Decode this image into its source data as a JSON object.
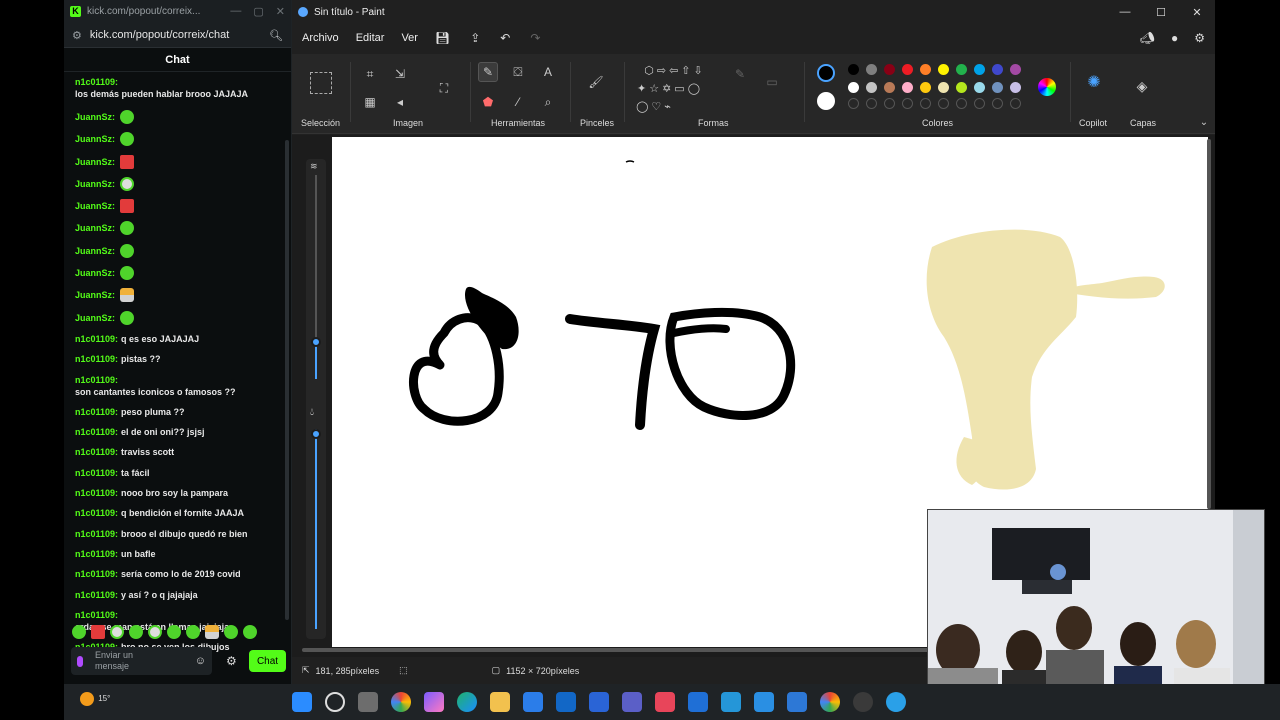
{
  "chat_window": {
    "title": "kick.com/popout/correix...",
    "url": "kick.com/popout/correix/chat",
    "header": "Chat",
    "messages": [
      {
        "user": "n1c01109:",
        "text": "los demás pueden hablar brooo JAJAJA"
      },
      {
        "user": "JuannSz:",
        "text": "",
        "emote": "green-smile-emote"
      },
      {
        "user": "JuannSz:",
        "text": "",
        "emote": "green-smile-emote"
      },
      {
        "user": "JuannSz:",
        "text": "",
        "emote": "red-angry-emote"
      },
      {
        "user": "JuannSz:",
        "text": "",
        "emote": "white-skull-emote"
      },
      {
        "user": "JuannSz:",
        "text": "",
        "emote": "red-angry-emote"
      },
      {
        "user": "JuannSz:",
        "text": "",
        "emote": "green-smile-emote"
      },
      {
        "user": "JuannSz:",
        "text": "",
        "emote": "green-smile-emote"
      },
      {
        "user": "JuannSz:",
        "text": "",
        "emote": "green-smile-emote"
      },
      {
        "user": "JuannSz:",
        "text": "",
        "emote": "monkey-emote"
      },
      {
        "user": "JuannSz:",
        "text": "",
        "emote": "green-smile-emote"
      },
      {
        "user": "n1c01109:",
        "text": "q es eso JAJAJAJ"
      },
      {
        "user": "n1c01109:",
        "text": "pistas ??"
      },
      {
        "user": "n1c01109:",
        "text": "son cantantes iconicos o famosos ??"
      },
      {
        "user": "n1c01109:",
        "text": "peso pluma ??"
      },
      {
        "user": "n1c01109:",
        "text": "el de oni oni?? jsjsj"
      },
      {
        "user": "n1c01109:",
        "text": "traviss scott"
      },
      {
        "user": "n1c01109:",
        "text": "ta fácil"
      },
      {
        "user": "n1c01109:",
        "text": "nooo bro soy la pampara"
      },
      {
        "user": "n1c01109:",
        "text": "q bendición el fornite JAAJA"
      },
      {
        "user": "n1c01109:",
        "text": "brooo el dibujo quedó re bien"
      },
      {
        "user": "n1c01109:",
        "text": "un bafle"
      },
      {
        "user": "n1c01109:",
        "text": "sería como lo de 2019 covid"
      },
      {
        "user": "n1c01109:",
        "text": "y así ? o q jajajaja"
      },
      {
        "user": "n1c01109:",
        "text": "erda ese man está en llamas jajajaja"
      },
      {
        "user": "n1c01109:",
        "text": "bro no se ven los dibujos"
      }
    ],
    "input_placeholder": "Enviar un mensaje",
    "send_label": "Chat"
  },
  "paint": {
    "title": "Sin título - Paint",
    "menu": [
      "Archivo",
      "Editar",
      "Ver"
    ],
    "groups": {
      "seleccion": "Selección",
      "imagen": "Imagen",
      "herramientas": "Herramientas",
      "pinceles": "Pinceles",
      "formas": "Formas",
      "colores": "Colores",
      "copilot": "Copilot",
      "capas": "Capas"
    },
    "palette_row1": [
      "#000000",
      "#7f7f7f",
      "#880015",
      "#ed1c24",
      "#ff7f27",
      "#fff200",
      "#22b14c",
      "#00a2e8",
      "#3f48cc",
      "#a349a4"
    ],
    "palette_row2": [
      "#ffffff",
      "#c3c3c3",
      "#b97a57",
      "#ffaec9",
      "#ffc90e",
      "#efe4b0",
      "#b5e61d",
      "#99d9ea",
      "#7092be",
      "#c8bfe7"
    ],
    "status": {
      "cursor": "181, 285píxeles",
      "size": "1152 × 720píxeles"
    }
  },
  "taskbar": {
    "temperature": "15°"
  }
}
